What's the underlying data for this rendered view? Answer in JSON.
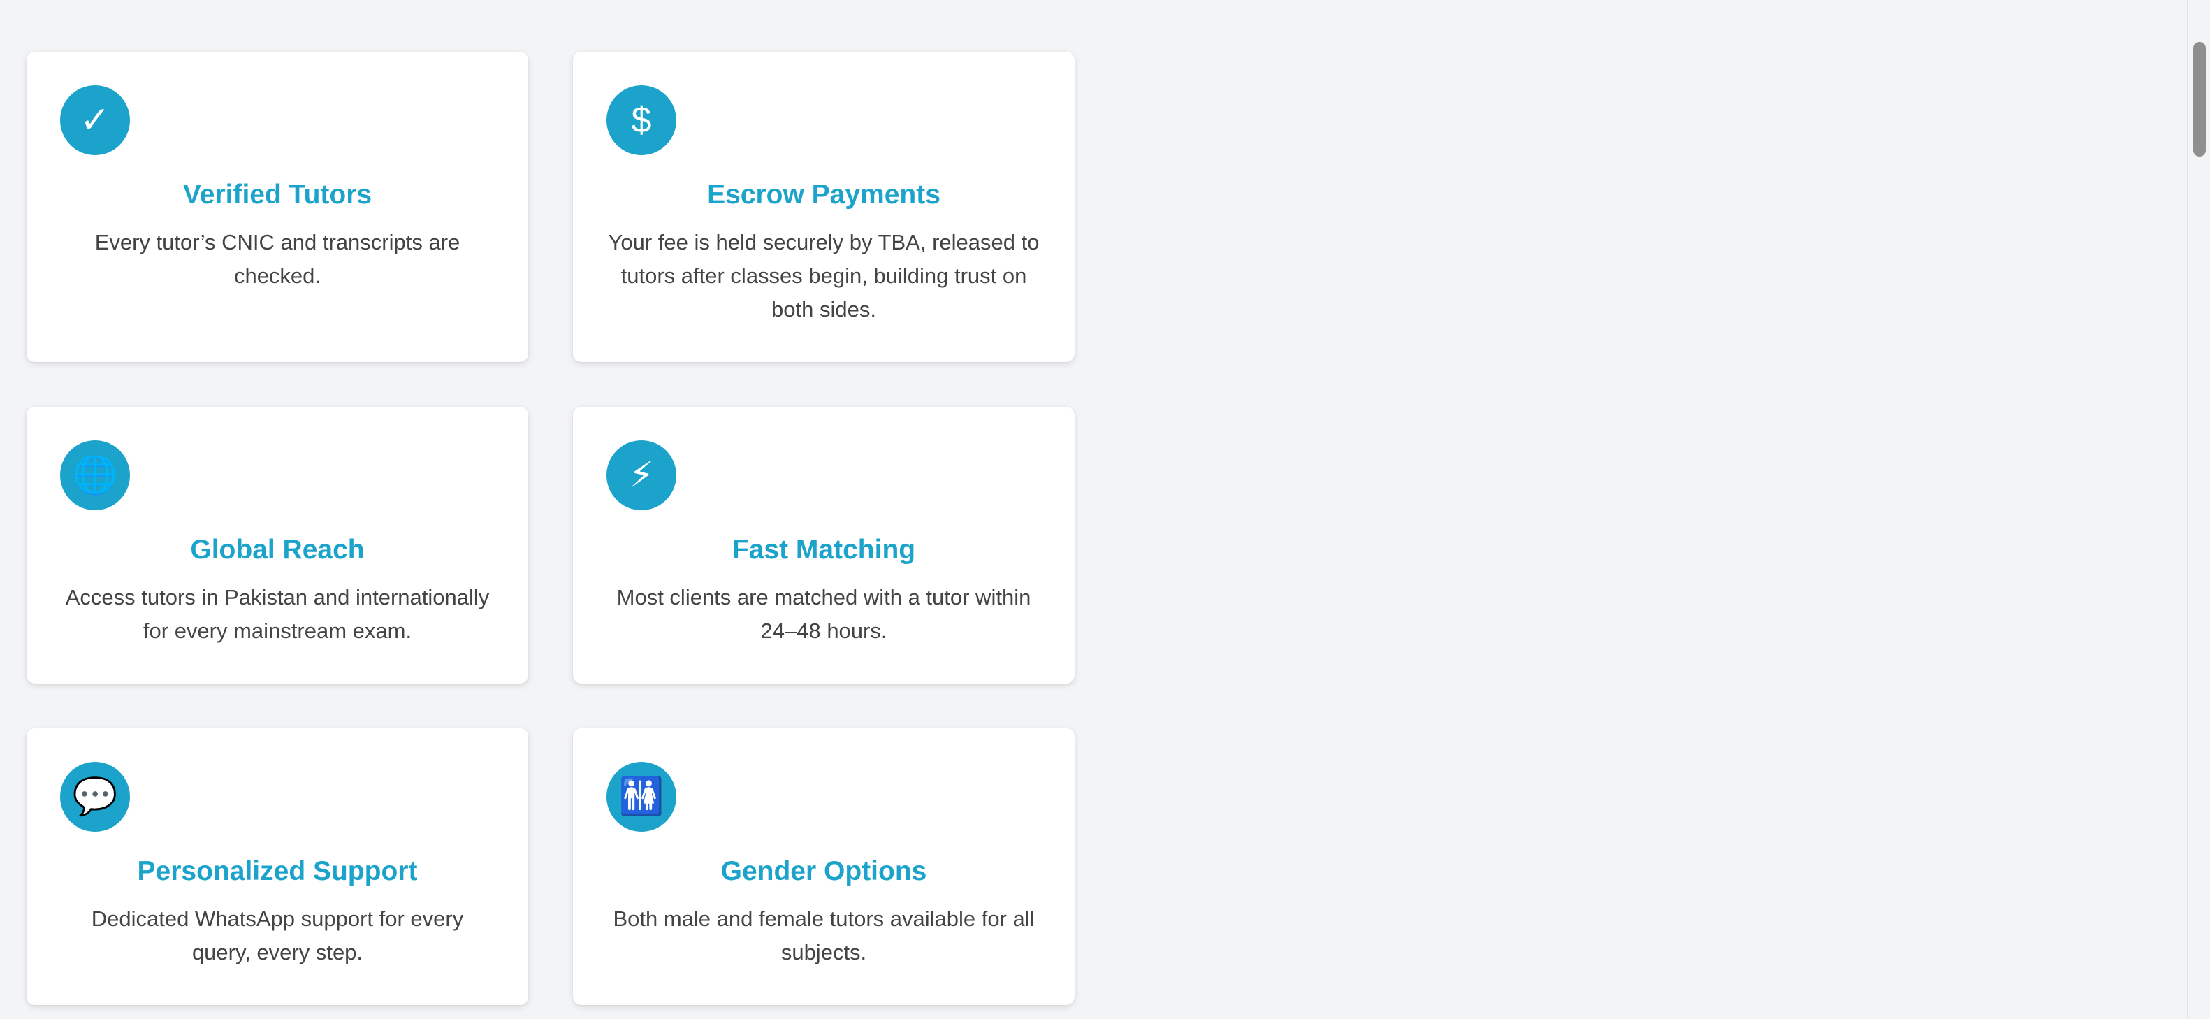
{
  "features": [
    {
      "icon": "checkmark-icon",
      "glyph": "✓",
      "title": "Verified Tutors",
      "description": "Every tutor’s CNIC and transcripts are checked."
    },
    {
      "icon": "dollar-icon",
      "glyph": "$",
      "title": "Escrow Payments",
      "description": "Your fee is held securely by TBA, released to tutors after classes begin, building trust on both sides."
    },
    {
      "icon": "globe-icon",
      "glyph": "🌐",
      "title": "Global Reach",
      "description": "Access tutors in Pakistan and internationally for every mainstream exam."
    },
    {
      "icon": "lightning-icon",
      "glyph": "⚡",
      "title": "Fast Matching",
      "description": "Most clients are matched with a tutor within 24–48 hours."
    },
    {
      "icon": "chat-bubble-icon",
      "glyph": "💬",
      "title": "Personalized Support",
      "description": "Dedicated WhatsApp support for every query, every step."
    },
    {
      "icon": "restroom-icon",
      "glyph": "🚻",
      "title": "Gender Options",
      "description": "Both male and female tutors available for all subjects."
    }
  ],
  "colors": {
    "accent": "#1ba3cb",
    "background": "#f3f4f6",
    "card": "#ffffff",
    "text": "#444444"
  }
}
